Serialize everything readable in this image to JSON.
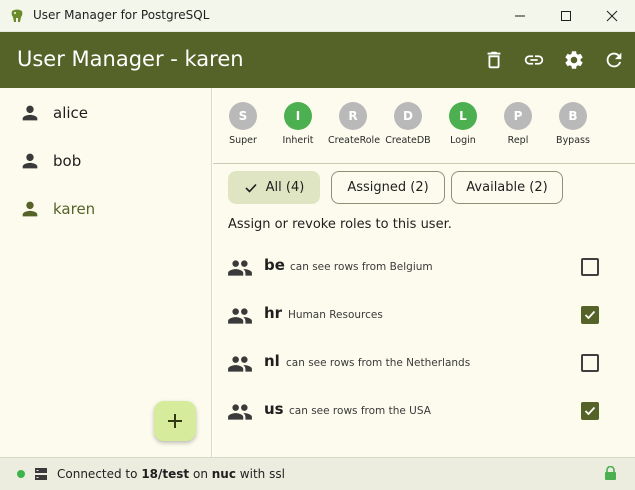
{
  "window": {
    "title": "User Manager for PostgreSQL"
  },
  "header": {
    "title": "User Manager - karen",
    "actions": [
      "delete-icon",
      "link-icon",
      "settings-icon",
      "refresh-icon"
    ]
  },
  "sidebar": {
    "users": [
      {
        "name": "alice",
        "active": false
      },
      {
        "name": "bob",
        "active": false
      },
      {
        "name": "karen",
        "active": true
      }
    ],
    "add_icon": "plus-icon"
  },
  "attributes": [
    {
      "letter": "S",
      "label": "Super",
      "enabled": false
    },
    {
      "letter": "I",
      "label": "Inherit",
      "enabled": true
    },
    {
      "letter": "R",
      "label": "CreateRole",
      "enabled": false
    },
    {
      "letter": "D",
      "label": "CreateDB",
      "enabled": false
    },
    {
      "letter": "L",
      "label": "Login",
      "enabled": true
    },
    {
      "letter": "P",
      "label": "Repl",
      "enabled": false
    },
    {
      "letter": "B",
      "label": "Bypass",
      "enabled": false
    }
  ],
  "filters": [
    {
      "label": "All (4)",
      "active": true
    },
    {
      "label": "Assigned (2)",
      "active": false
    },
    {
      "label": "Available (2)",
      "active": false
    }
  ],
  "hint": "Assign or revoke roles to this user.",
  "roles": [
    {
      "name": "be",
      "description": "can see rows from Belgium",
      "checked": false
    },
    {
      "name": "hr",
      "description": "Human Resources",
      "checked": true
    },
    {
      "name": "nl",
      "description": "can see rows from the Netherlands",
      "checked": false
    },
    {
      "name": "us",
      "description": "can see rows from the USA",
      "checked": true
    }
  ],
  "status": {
    "prefix": "Connected to",
    "database": "18/test",
    "on": "on",
    "host": "nuc",
    "suffix": "with ssl"
  },
  "colors": {
    "primary": "#556228",
    "enabled": "#4caf50",
    "disabled": "#b9b9b9",
    "status_ok": "#3cb44b"
  }
}
